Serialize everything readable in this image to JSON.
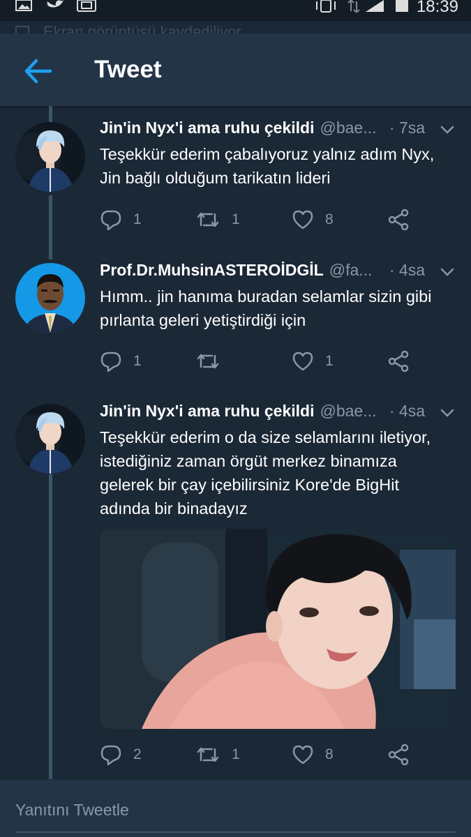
{
  "status_bar": {
    "time": "18:39"
  },
  "notification": {
    "text": "Ekran görüntüsü kaydediliyor..."
  },
  "header": {
    "title": "Tweet"
  },
  "tweets": [
    {
      "name": "Jin'in Nyx'i ama ruhu çekildi",
      "handle": "@bae...",
      "time": "· 7sa",
      "text_lines": [
        "Teşekkür ederim çabalıyoruz yalnız adım Nyx,",
        "Jin bağlı olduğum tarikatın lideri"
      ],
      "replies": "1",
      "retweets": "1",
      "likes": "8"
    },
    {
      "name": "Prof.Dr.MuhsinASTEROİDGİL",
      "handle": "@fa...",
      "time": "· 4sa",
      "text_lines": [
        "Hımm.. jin hanıma buradan selamlar sizin gibi",
        "pırlanta geleri yetiştirdiği için"
      ],
      "replies": "1",
      "retweets": "",
      "likes": "1"
    },
    {
      "name": "Jin'in Nyx'i ama ruhu çekildi",
      "handle": "@bae...",
      "time": "· 4sa",
      "text_lines": [
        "Teşekkür ederim o da size selamlarını iletiyor,",
        "istediğiniz zaman örgüt merkez binamıza",
        "gelerek bir çay içebilirsiniz Kore'de BigHit",
        "adında bir binadayız"
      ],
      "replies": "2",
      "retweets": "1",
      "likes": "8"
    }
  ],
  "reply_bar": {
    "placeholder": "Yanıtını Tweetle"
  },
  "colors": {
    "background": "#1b2836",
    "header": "#243447",
    "accent": "#1da1f2",
    "muted": "#8899a6"
  },
  "icons": [
    "gallery-icon",
    "twitter-icon",
    "app-icon",
    "vibrate-icon",
    "data-icon",
    "signal-icon",
    "battery-icon",
    "back-arrow-icon",
    "chevron-down-icon",
    "reply-icon",
    "retweet-icon",
    "like-icon",
    "share-icon"
  ]
}
